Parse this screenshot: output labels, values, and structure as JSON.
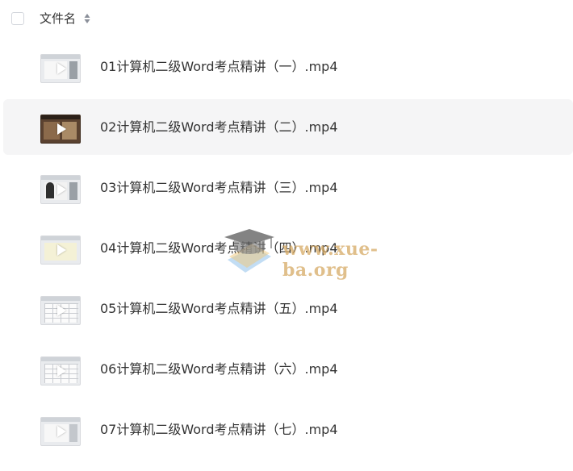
{
  "header": {
    "column_title": "文件名"
  },
  "files": [
    {
      "name": "01计算机二级Word考点精讲（一）.mp4",
      "thumb": "video-thumb"
    },
    {
      "name": "02计算机二级Word考点精讲（二）.mp4",
      "thumb": "video-thumb"
    },
    {
      "name": "03计算机二级Word考点精讲（三）.mp4",
      "thumb": "video-thumb"
    },
    {
      "name": "04计算机二级Word考点精讲（四）.mp4",
      "thumb": "video-thumb"
    },
    {
      "name": "05计算机二级Word考点精讲（五）.mp4",
      "thumb": "video-thumb"
    },
    {
      "name": "06计算机二级Word考点精讲（六）.mp4",
      "thumb": "video-thumb"
    },
    {
      "name": "07计算机二级Word考点精讲（七）.mp4",
      "thumb": "video-thumb"
    }
  ],
  "watermark": {
    "text": "www.xue-ba.org"
  },
  "colors": {
    "text": "#333333",
    "hover_row": "#f5f5f6",
    "watermark": "#d6aa64"
  },
  "icons": {
    "checkbox": "checkbox-icon",
    "sort": "sort-icon",
    "play": "play-icon",
    "logo": "graduation-cap-icon"
  }
}
